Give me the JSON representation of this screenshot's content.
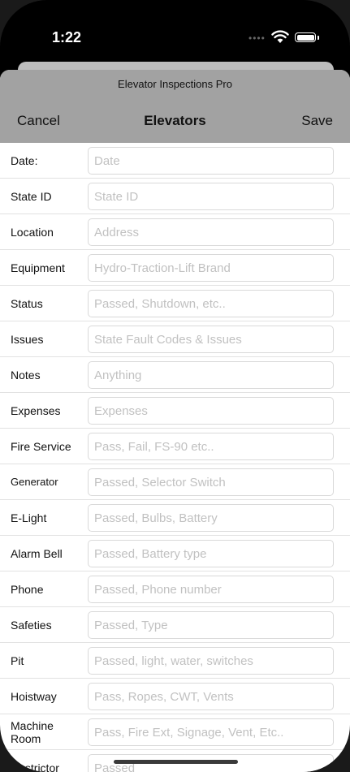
{
  "status_bar": {
    "time": "1:22"
  },
  "nav": {
    "app_title": "Elevator Inspections Pro",
    "cancel_label": "Cancel",
    "title": "Elevators",
    "save_label": "Save"
  },
  "form": {
    "rows": [
      {
        "label": "Date:",
        "placeholder": "Date",
        "value": ""
      },
      {
        "label": "State ID",
        "placeholder": "State ID",
        "value": ""
      },
      {
        "label": "Location",
        "placeholder": "Address",
        "value": ""
      },
      {
        "label": "Equipment",
        "placeholder": "Hydro-Traction-Lift Brand",
        "value": ""
      },
      {
        "label": "Status",
        "placeholder": "Passed, Shutdown, etc..",
        "value": ""
      },
      {
        "label": "Issues",
        "placeholder": "State Fault Codes & Issues",
        "value": ""
      },
      {
        "label": "Notes",
        "placeholder": "Anything",
        "value": ""
      },
      {
        "label": "Expenses",
        "placeholder": "Expenses",
        "value": ""
      },
      {
        "label": "Fire Service",
        "placeholder": "Pass, Fail, FS-90 etc..",
        "value": ""
      },
      {
        "label": "Generator",
        "placeholder": "Passed, Selector Switch",
        "value": ""
      },
      {
        "label": "E-Light",
        "placeholder": "Passed, Bulbs, Battery",
        "value": ""
      },
      {
        "label": "Alarm Bell",
        "placeholder": "Passed, Battery type",
        "value": ""
      },
      {
        "label": "Phone",
        "placeholder": "Passed, Phone number",
        "value": ""
      },
      {
        "label": "Safeties",
        "placeholder": "Passed, Type",
        "value": ""
      },
      {
        "label": "Pit",
        "placeholder": "Passed, light, water, switches",
        "value": ""
      },
      {
        "label": "Hoistway",
        "placeholder": "Pass, Ropes, CWT, Vents",
        "value": ""
      },
      {
        "label": "Machine Room",
        "placeholder": "Pass, Fire Ext, Signage, Vent, Etc..",
        "value": ""
      },
      {
        "label": "Restrictor",
        "placeholder": "Passed",
        "value": ""
      }
    ]
  },
  "colors": {
    "nav_bg": "#a2a2a2",
    "placeholder": "#c1c1c1",
    "border": "#d9d9d9"
  }
}
